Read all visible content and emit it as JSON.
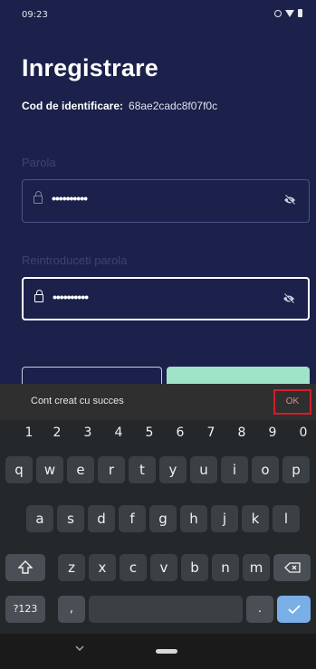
{
  "status_bar": {
    "time": "09:23",
    "icons": [
      "sync-icon",
      "wifi-icon",
      "battery-icon"
    ]
  },
  "page": {
    "title": "Inregistrare",
    "id_label": "Cod de identificare:",
    "id_value": "68ae2cadc8f07f0c"
  },
  "fields": [
    {
      "label": "Parola",
      "masked_value": "••••••••••",
      "lock_icon": "lock-icon",
      "visibility_icon": "eye-off-icon"
    },
    {
      "label": "Reintroduceti parola",
      "masked_value": "••••••••••",
      "lock_icon": "lock-icon",
      "visibility_icon": "eye-off-icon"
    }
  ],
  "snackbar": {
    "message": "Cont creat cu succes",
    "action": "OK"
  },
  "keyboard": {
    "numbers": [
      "1",
      "2",
      "3",
      "4",
      "5",
      "6",
      "7",
      "8",
      "9",
      "0"
    ],
    "row1": [
      "q",
      "w",
      "e",
      "r",
      "t",
      "y",
      "u",
      "i",
      "o",
      "p"
    ],
    "row2": [
      "a",
      "s",
      "d",
      "f",
      "g",
      "h",
      "j",
      "k",
      "l"
    ],
    "row3": [
      "z",
      "x",
      "c",
      "v",
      "b",
      "n",
      "m"
    ],
    "symbols_key": "?123",
    "comma": ",",
    "period": "."
  },
  "colors": {
    "background": "#1b214a",
    "accent_green": "#9fe3c9",
    "highlight_red": "#d21f2a",
    "enter_key": "#7aaee6"
  }
}
